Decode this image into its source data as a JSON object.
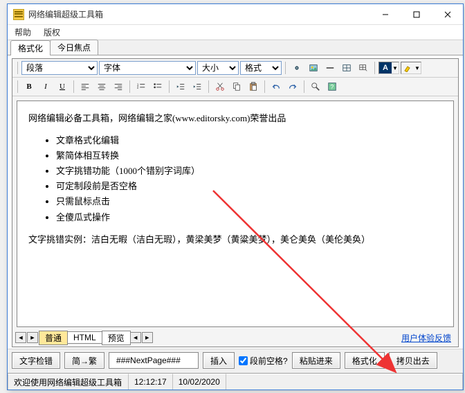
{
  "title": "网络编辑超级工具箱",
  "menu": {
    "help": "帮助",
    "copyright": "版权"
  },
  "topTabs": {
    "format": "格式化",
    "today": "今日焦点"
  },
  "toolbar": {
    "paragraph": "段落",
    "font": "字体",
    "size": "大小",
    "format": "格式"
  },
  "content": {
    "intro": "网络编辑必备工具箱，网络编辑之家(www.editorsky.com)荣誉出品",
    "items": [
      "文章格式化编辑",
      "繁简体相互转换",
      "文字挑错功能（1000个错别字词库）",
      "可定制段前是否空格",
      "只需鼠标点击",
      "全傻瓜式操作"
    ],
    "example": "文字挑错实例：洁白无暇（洁白无瑕），黄梁美梦（黄粱美梦），美仑美奂（美伦美奂）"
  },
  "lowerTabs": {
    "normal": "普通",
    "html": "HTML",
    "preview": "预览"
  },
  "feedback": "用户体验反馈",
  "actions": {
    "check": "文字检错",
    "convert": "简→繁",
    "pagebreak": "###NextPage###",
    "insert": "插入",
    "spaceLabel": "段前空格?",
    "paste": "粘贴进来",
    "format": "格式化",
    "copyout": "拷贝出去"
  },
  "status": {
    "welcome": "欢迎使用网络编辑超级工具箱",
    "time": "12:12:17",
    "date": "10/02/2020"
  }
}
